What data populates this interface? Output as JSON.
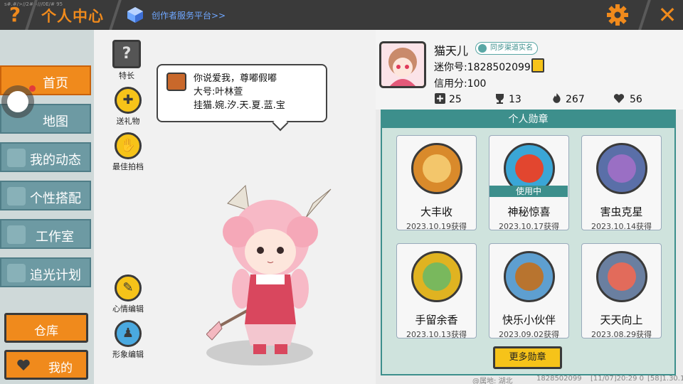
{
  "header": {
    "title": "个人中心",
    "creator_platform": "创作者服务平台>>",
    "help_glyph": "?",
    "close_glyph": "✕",
    "tiny_text": "s#.#/>//2##///0E/# 95"
  },
  "nav": {
    "items": [
      {
        "label": "首页",
        "icon": "home-icon"
      },
      {
        "label": "地图",
        "icon": "map-icon"
      },
      {
        "label": "我的动态",
        "icon": "bell-icon"
      },
      {
        "label": "个性搭配",
        "icon": "shirt-icon"
      },
      {
        "label": "工作室",
        "icon": "tool-icon"
      },
      {
        "label": "追光计划",
        "icon": "light-icon"
      }
    ],
    "warehouse": "仓库",
    "mine": "我的"
  },
  "side_buttons": {
    "specialty": "特长",
    "gift": "送礼物",
    "best_photo": "最佳拍档",
    "mood_edit": "心情编辑",
    "look_edit": "形象编辑"
  },
  "bubble": {
    "line1": "你说爱我，尊嘟假嘟",
    "line2": "大号:叶林萱",
    "line3": "挂猫.婉.汐.天.夏.蓝.宝"
  },
  "profile": {
    "name": "猫天儿",
    "sync_badge": "同步渠道实名",
    "mini_id": "迷你号:1828502099",
    "credit": "信用分:100",
    "stats": [
      {
        "icon": "plus-icon",
        "value": "25"
      },
      {
        "icon": "trophy-icon",
        "value": "13"
      },
      {
        "icon": "flame-icon",
        "value": "267"
      },
      {
        "icon": "heart-hand-icon",
        "value": "56"
      }
    ]
  },
  "badges": {
    "title": "个人勋章",
    "in_use": "使用中",
    "items": [
      {
        "name": "大丰收",
        "date": "2023.10.19获得",
        "color": "#d98a2b",
        "inner": "#f3c66b"
      },
      {
        "name": "神秘惊喜",
        "date": "2023.10.17获得",
        "color": "#3aa6d6",
        "inner": "#e2462f"
      },
      {
        "name": "害虫克星",
        "date": "2023.10.14获得",
        "color": "#5a6fa8",
        "inner": "#9a6fc4"
      },
      {
        "name": "手留余香",
        "date": "2023.10.13获得",
        "color": "#e0b321",
        "inner": "#79b85d"
      },
      {
        "name": "快乐小伙伴",
        "date": "2023.09.02获得",
        "color": "#5e9fd0",
        "inner": "#b8742f"
      },
      {
        "name": "天天向上",
        "date": "2023.08.29获得",
        "color": "#6a7fa0",
        "inner": "#e26b5b"
      }
    ],
    "more": "更多勋章"
  },
  "footer": {
    "location": "@属地: 湖北",
    "id": "1828502099",
    "time": "[11/07]20:29 0",
    "version": "[58]1.30.1"
  },
  "colors": {
    "accent": "#f08a1c",
    "teal": "#3d8f8c",
    "yellow": "#f6c319"
  }
}
